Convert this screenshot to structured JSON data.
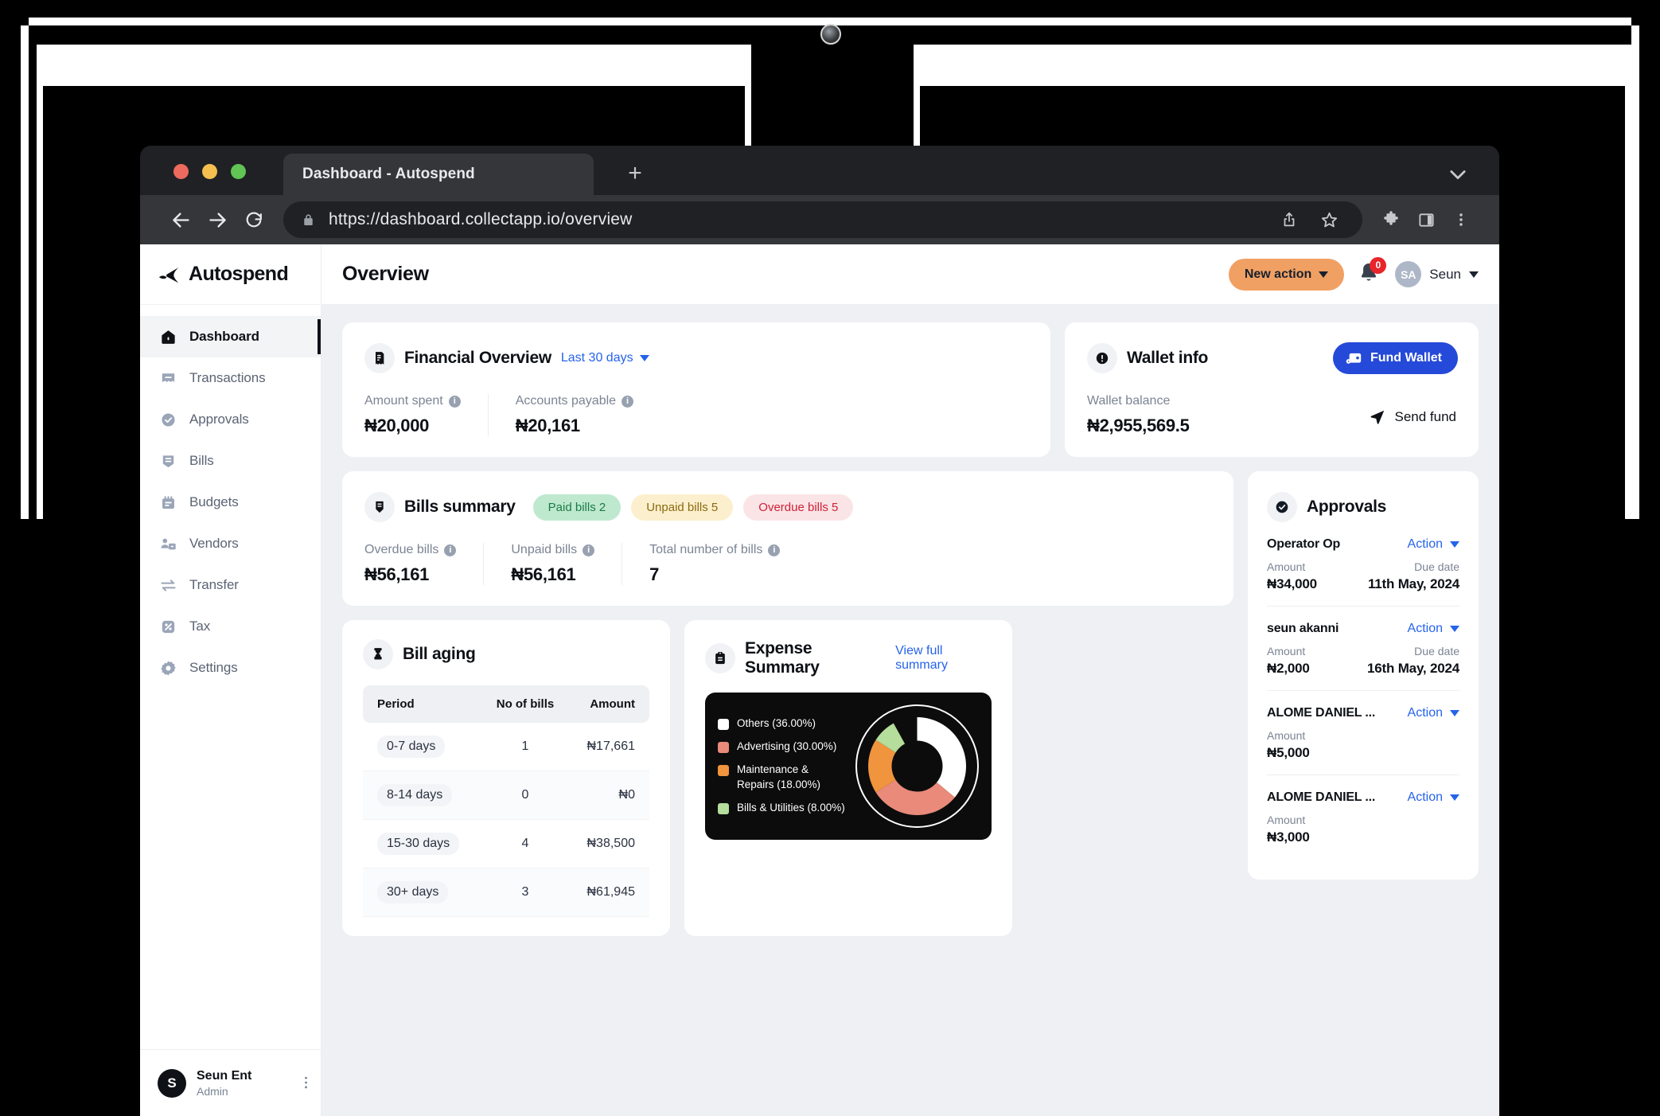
{
  "browser": {
    "tab_title": "Dashboard - Autospend",
    "new_tab_label": "+",
    "url": "https://dashboard.collectapp.io/overview",
    "icons": {
      "back": "back-arrow-icon",
      "forward": "forward-arrow-icon",
      "reload": "reload-icon",
      "lock": "lock-icon",
      "share": "share-icon",
      "bookmark": "star-icon",
      "extensions": "puzzle-icon",
      "side_panel": "side-panel-icon",
      "menu": "three-dot-menu-icon",
      "tabstrip_chevron": "chevron-down-icon"
    }
  },
  "sidebar": {
    "brand": "Autospend",
    "items": [
      {
        "label": "Dashboard",
        "icon": "home-icon",
        "active": true
      },
      {
        "label": "Transactions",
        "icon": "transactions-icon",
        "active": false
      },
      {
        "label": "Approvals",
        "icon": "check-circle-icon",
        "active": false
      },
      {
        "label": "Bills",
        "icon": "bills-icon",
        "active": false
      },
      {
        "label": "Budgets",
        "icon": "budgets-icon",
        "active": false
      },
      {
        "label": "Vendors",
        "icon": "vendors-icon",
        "active": false
      },
      {
        "label": "Transfer",
        "icon": "transfer-icon",
        "active": false
      },
      {
        "label": "Tax",
        "icon": "percent-icon",
        "active": false
      },
      {
        "label": "Settings",
        "icon": "gear-icon",
        "active": false
      }
    ],
    "footer": {
      "avatar_initial": "S",
      "org_name": "Seun Ent",
      "role": "Admin",
      "menu_icon": "kebab-menu-icon"
    }
  },
  "header": {
    "title": "Overview",
    "new_action_label": "New action",
    "notification_count": "0",
    "user_initials": "SA",
    "user_name": "Seun"
  },
  "financial_overview": {
    "title": "Financial Overview",
    "period": "Last 30 days",
    "metrics": [
      {
        "label": "Amount spent",
        "value": "₦20,000"
      },
      {
        "label": "Accounts payable",
        "value": "₦20,161"
      }
    ]
  },
  "wallet_info": {
    "title": "Wallet info",
    "fund_wallet_label": "Fund Wallet",
    "send_fund_label": "Send fund",
    "balance_label": "Wallet balance",
    "balance_value": "₦2,955,569.5"
  },
  "bills_summary": {
    "title": "Bills summary",
    "pills": [
      {
        "label": "Paid bills 2",
        "kind": "paid"
      },
      {
        "label": "Unpaid bills 5",
        "kind": "unpaid"
      },
      {
        "label": "Overdue bills 5",
        "kind": "overdue"
      }
    ],
    "metrics": [
      {
        "label": "Overdue bills",
        "value": "₦56,161"
      },
      {
        "label": "Unpaid bills",
        "value": "₦56,161"
      },
      {
        "label": "Total number of bills",
        "value": "7"
      }
    ]
  },
  "approvals": {
    "title": "Approvals",
    "action_label": "Action",
    "amount_label": "Amount",
    "due_date_label": "Due date",
    "rows": [
      {
        "name": "Operator Op",
        "amount": "₦34,000",
        "due_date": "11th May, 2024"
      },
      {
        "name": "seun akanni",
        "amount": "₦2,000",
        "due_date": "16th May, 2024"
      },
      {
        "name": "ALOME DANIEL ...",
        "amount": "₦5,000",
        "due_date": ""
      },
      {
        "name": "ALOME DANIEL ...",
        "amount": "₦3,000",
        "due_date": ""
      }
    ]
  },
  "bill_aging": {
    "title": "Bill aging",
    "columns": [
      "Period",
      "No of bills",
      "Amount"
    ],
    "rows": [
      {
        "period": "0-7 days",
        "count": "1",
        "amount": "₦17,661"
      },
      {
        "period": "8-14 days",
        "count": "0",
        "amount": "₦0"
      },
      {
        "period": "15-30 days",
        "count": "4",
        "amount": "₦38,500"
      },
      {
        "period": "30+ days",
        "count": "3",
        "amount": "₦61,945"
      }
    ]
  },
  "expense_summary": {
    "title": "Expense Summary",
    "view_full_label": "View full summary"
  },
  "chart_data": {
    "type": "pie",
    "title": "Expense Summary",
    "subtitle": "",
    "legend_position": "left",
    "donut": true,
    "inner_radius_ratio": 0.48,
    "start_angle_deg": 0,
    "direction": "clockwise",
    "labels": [
      "Others",
      "Advertising",
      "Maintenance & Repairs",
      "Bills & Utilities"
    ],
    "values": [
      36.0,
      30.0,
      18.0,
      8.0
    ],
    "value_suffix": "%",
    "legend_entries": [
      "Others  (36.00%)",
      "Advertising  (30.00%)",
      "Maintenance & Repairs  (18.00%)",
      "Bills & Utilities  (8.00%)"
    ],
    "colors": [
      "#ffffff",
      "#e98a7a",
      "#f0943e",
      "#b5dd9b"
    ],
    "background": "#0c0c0c",
    "grid": false
  },
  "colors": {
    "accent_orange": "#f1a063",
    "accent_blue": "#2549d8",
    "link_blue": "#2563eb",
    "dark": "#0e1116",
    "badge_red": "#e8252a",
    "app_bg": "#eef0f3"
  }
}
